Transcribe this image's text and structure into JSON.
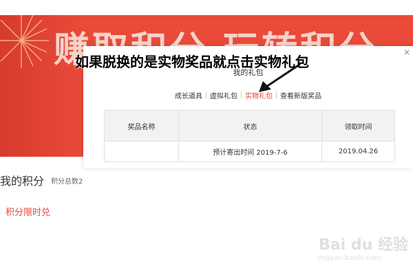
{
  "banner": {
    "text": "赚取积分 玩转积分"
  },
  "sidebar": {
    "my_points_title": "我的积分",
    "points_total_label": "积分总数2",
    "limited_exchange": "积分限时兑"
  },
  "modal": {
    "close": "×",
    "title": "我的礼包",
    "tabs": [
      {
        "label": "成长道具"
      },
      {
        "label": "虚拟礼包"
      },
      {
        "label": "实物礼包",
        "active": true
      },
      {
        "label": "查看新版奖品"
      }
    ],
    "table": {
      "columns": [
        "奖品名称",
        "状态",
        "领取时间"
      ],
      "rows": [
        [
          "",
          "预计寄出时间 2019-7-6",
          "2019.04.26"
        ]
      ]
    }
  },
  "annotation": {
    "text": "如果脱换的是实物奖品就点击实物礼包"
  },
  "watermark": {
    "brand": "Bai du 经验",
    "url": "jingyan.baidu.com"
  },
  "colors": {
    "banner_red": "#e94a3a",
    "accent_red": "#e2483a",
    "table_header_bg": "#f2f2f2"
  }
}
